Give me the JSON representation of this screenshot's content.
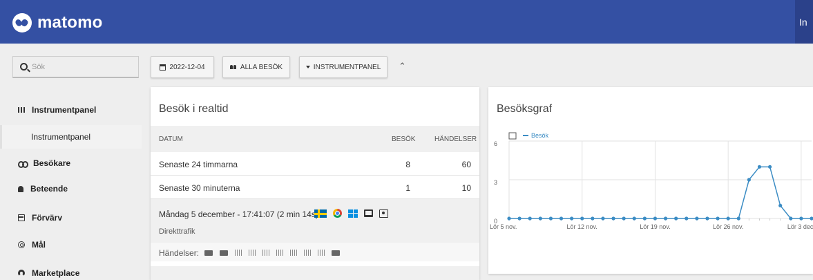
{
  "header": {
    "brand": "matomo",
    "right_text": "In"
  },
  "search": {
    "placeholder": "Sök"
  },
  "controls": {
    "date": "2022-12-04",
    "segment": "ALLA BESÖK",
    "dashboard": "INSTRUMENTPANEL"
  },
  "sidebar": {
    "items": [
      {
        "label": "Instrumentpanel",
        "icon": "dashboard-icon"
      },
      {
        "label": "Besökare",
        "icon": "binoculars-icon"
      },
      {
        "label": "Beteende",
        "icon": "bell-icon"
      },
      {
        "label": "Förvärv",
        "icon": "acquisition-icon"
      },
      {
        "label": "Mål",
        "icon": "target-icon"
      },
      {
        "label": "Marketplace",
        "icon": "marketplace-icon"
      }
    ],
    "sub_item": "Instrumentpanel"
  },
  "realtime": {
    "title": "Besök i realtid",
    "columns": {
      "date": "DATUM",
      "visits": "BESÖK",
      "events": "HÄNDELSER"
    },
    "rows": [
      {
        "label": "Senaste 24 timmarna",
        "visits": "8",
        "events": "60"
      },
      {
        "label": "Senaste 30 minuterna",
        "visits": "1",
        "events": "10"
      }
    ],
    "visit": {
      "header": "Måndag 5 december - 17:41:07 (2 min 14s)",
      "source": "Direkttrafik",
      "events_label": "Händelser:"
    }
  },
  "graph": {
    "title": "Besöksgraf",
    "legend_label": "Besök",
    "line_color": "#3b8cc4"
  },
  "chart_data": {
    "type": "line",
    "title": "Besöksgraf",
    "x": [
      "Lör 5 nov.",
      "",
      "",
      "",
      "",
      "",
      "",
      "Lör 12 nov.",
      "",
      "",
      "",
      "",
      "",
      "",
      "Lör 19 nov.",
      "",
      "",
      "",
      "",
      "",
      "",
      "Lör 26 nov.",
      "",
      "",
      "",
      "",
      "",
      "",
      "Lör 3 dec.",
      ""
    ],
    "tick_labels": [
      "Lör 5 nov.",
      "Lör 12 nov.",
      "Lör 19 nov.",
      "Lör 26 nov.",
      "Lör 3 dec."
    ],
    "y_ticks": [
      "0",
      "3",
      "6"
    ],
    "ylim": [
      0,
      6
    ],
    "grid": true,
    "legend": "top-left",
    "series": [
      {
        "name": "Besök",
        "values": [
          0,
          0,
          0,
          0,
          0,
          0,
          0,
          0,
          0,
          0,
          0,
          0,
          0,
          0,
          0,
          0,
          0,
          0,
          0,
          0,
          0,
          0,
          0,
          3,
          4,
          4,
          1,
          0,
          0,
          0
        ]
      }
    ]
  }
}
